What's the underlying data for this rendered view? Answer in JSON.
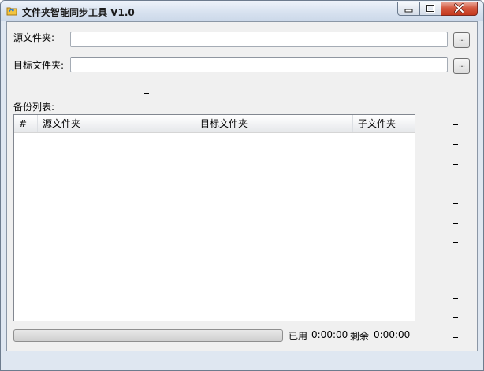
{
  "window": {
    "title": "文件夹智能同步工具 V1.0",
    "icon": "folder-sync-icon"
  },
  "form": {
    "source_label": "源文件夹:",
    "source_value": "",
    "target_label": "目标文件夹:",
    "target_value": "",
    "browse_label": "..."
  },
  "backup_list": {
    "label": "备份列表:",
    "columns": [
      "#",
      "源文件夹",
      "目标文件夹",
      "子文件夹"
    ],
    "rows": []
  },
  "status": {
    "progress": 0,
    "elapsed_label": "已用",
    "elapsed_value": "0:00:00",
    "remaining_label": "剩余",
    "remaining_value": "0:00:00"
  },
  "colors": {
    "close_button": "#c4381e",
    "progress_fill": "#06b025"
  }
}
